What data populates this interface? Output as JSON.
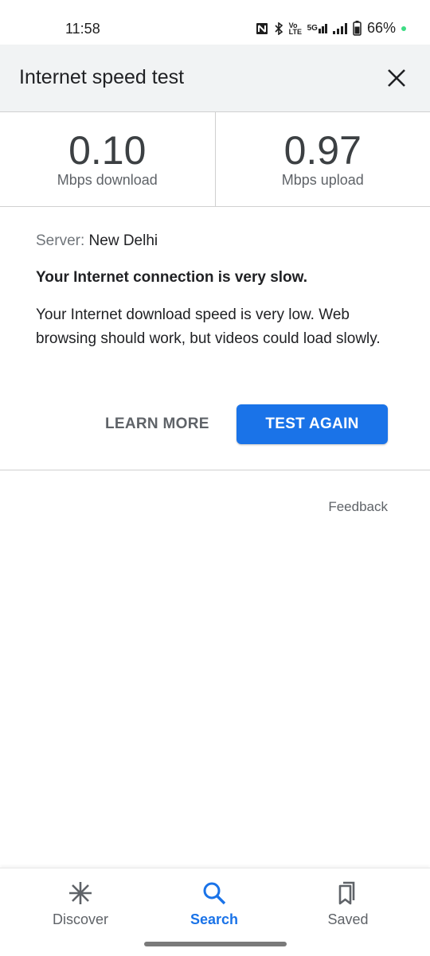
{
  "status_bar": {
    "time": "11:58",
    "icons": [
      "nfc-icon",
      "bluetooth-icon",
      "volte-icon",
      "5g-signal-icon",
      "signal-icon",
      "battery-icon"
    ],
    "volte_label": "Vo LTE",
    "network_label": "5G",
    "battery_percent": "66%"
  },
  "header": {
    "title": "Internet speed test",
    "close_icon": "close-icon"
  },
  "results": {
    "download": {
      "value": "0.10",
      "label": "Mbps download"
    },
    "upload": {
      "value": "0.97",
      "label": "Mbps upload"
    }
  },
  "details": {
    "server_label": "Server:",
    "server_value": "New Delhi",
    "verdict": "Your Internet connection is very slow.",
    "description": "Your Internet download speed is very low. Web browsing should work, but videos could load slowly."
  },
  "actions": {
    "learn_more": "LEARN MORE",
    "test_again": "TEST AGAIN"
  },
  "feedback": "Feedback",
  "bottom_nav": {
    "items": [
      {
        "label": "Discover",
        "icon": "discover-asterisk-icon",
        "active": false
      },
      {
        "label": "Search",
        "icon": "search-icon",
        "active": true
      },
      {
        "label": "Saved",
        "icon": "bookmarks-icon",
        "active": false
      }
    ]
  },
  "colors": {
    "accent": "#1a73e8",
    "header_bg": "#f1f3f4",
    "text_primary": "#202124",
    "text_secondary": "#5f6368"
  }
}
